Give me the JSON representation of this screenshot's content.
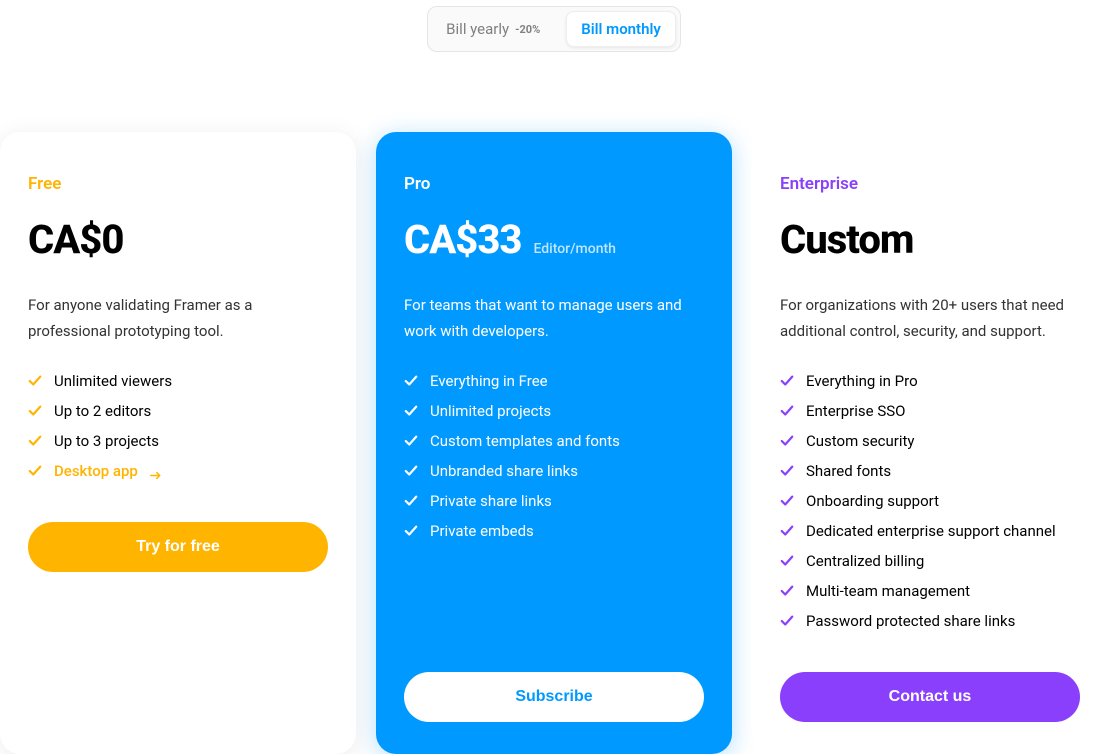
{
  "billing": {
    "yearly_label": "Bill yearly",
    "yearly_discount": "-20%",
    "monthly_label": "Bill monthly"
  },
  "plans": {
    "free": {
      "name": "Free",
      "price": "CA$0",
      "unit": "",
      "desc": "For anyone validating Framer as a professional prototyping tool.",
      "features": [
        "Unlimited viewers",
        "Up to 2 editors",
        "Up to 3 projects"
      ],
      "link_feature": "Desktop app",
      "cta": "Try for free"
    },
    "pro": {
      "name": "Pro",
      "price": "CA$33",
      "unit": "Editor/month",
      "desc": "For teams that want to manage users and work with developers.",
      "features": [
        "Everything in Free",
        "Unlimited projects",
        "Custom templates and fonts",
        "Unbranded share links",
        "Private share links",
        "Private embeds"
      ],
      "cta": "Subscribe"
    },
    "enterprise": {
      "name": "Enterprise",
      "price": "Custom",
      "unit": "",
      "desc": "For organizations with 20+ users that need additional control, security, and support.",
      "features": [
        "Everything in Pro",
        "Enterprise SSO",
        "Custom security",
        "Shared fonts",
        "Onboarding support",
        "Dedicated enterprise support channel",
        "Centralized billing",
        "Multi-team management",
        "Password protected share links"
      ],
      "cta": "Contact us"
    }
  }
}
